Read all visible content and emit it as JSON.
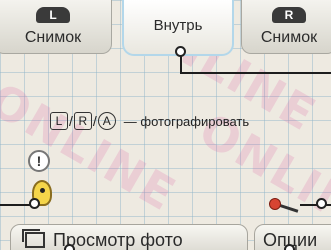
{
  "top_tabs": {
    "left": {
      "key": "L",
      "label": "Снимок"
    },
    "center": {
      "label": "Внутрь"
    },
    "right": {
      "key": "R",
      "label": "Снимок"
    }
  },
  "instruction": {
    "buttons": [
      "L",
      "R",
      "A"
    ],
    "separator": "/",
    "text": "— фотографировать"
  },
  "alert": {
    "symbol": "!"
  },
  "bottom_buttons": {
    "photos_label": "Просмотр фото",
    "options_label": "Опции"
  },
  "icons": {
    "gallery": "photo-gallery-icon",
    "alert": "exclamation-icon",
    "mascot": "bird-icon",
    "lever": "lever-icon"
  },
  "colors": {
    "selected_tab_border": "#b3d7ea",
    "grid": "#8cb4c8",
    "lever_knob": "#d74432"
  }
}
